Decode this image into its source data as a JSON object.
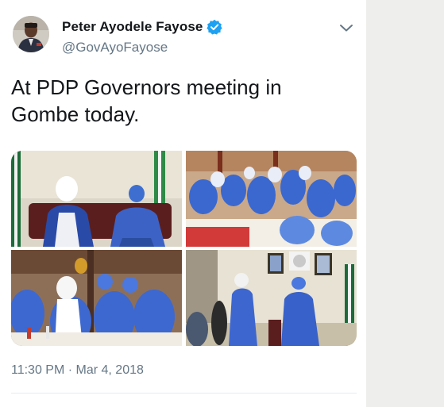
{
  "tweet": {
    "author": {
      "display_name": "Peter Ayodele Fayose",
      "handle": "@GovAyoFayose",
      "verified": true
    },
    "text_line1": "At PDP Governors meeting in",
    "text_line2": "Gombe today.",
    "timestamp": "11:30 PM · Mar 4, 2018",
    "menu_icon": "chevron-down-icon",
    "verified_icon": "verified-badge-icon"
  },
  "colors": {
    "primary_text": "#14171a",
    "secondary_text": "#657786",
    "verified_blue": "#1da1f2",
    "divider": "#e6ecf0"
  }
}
